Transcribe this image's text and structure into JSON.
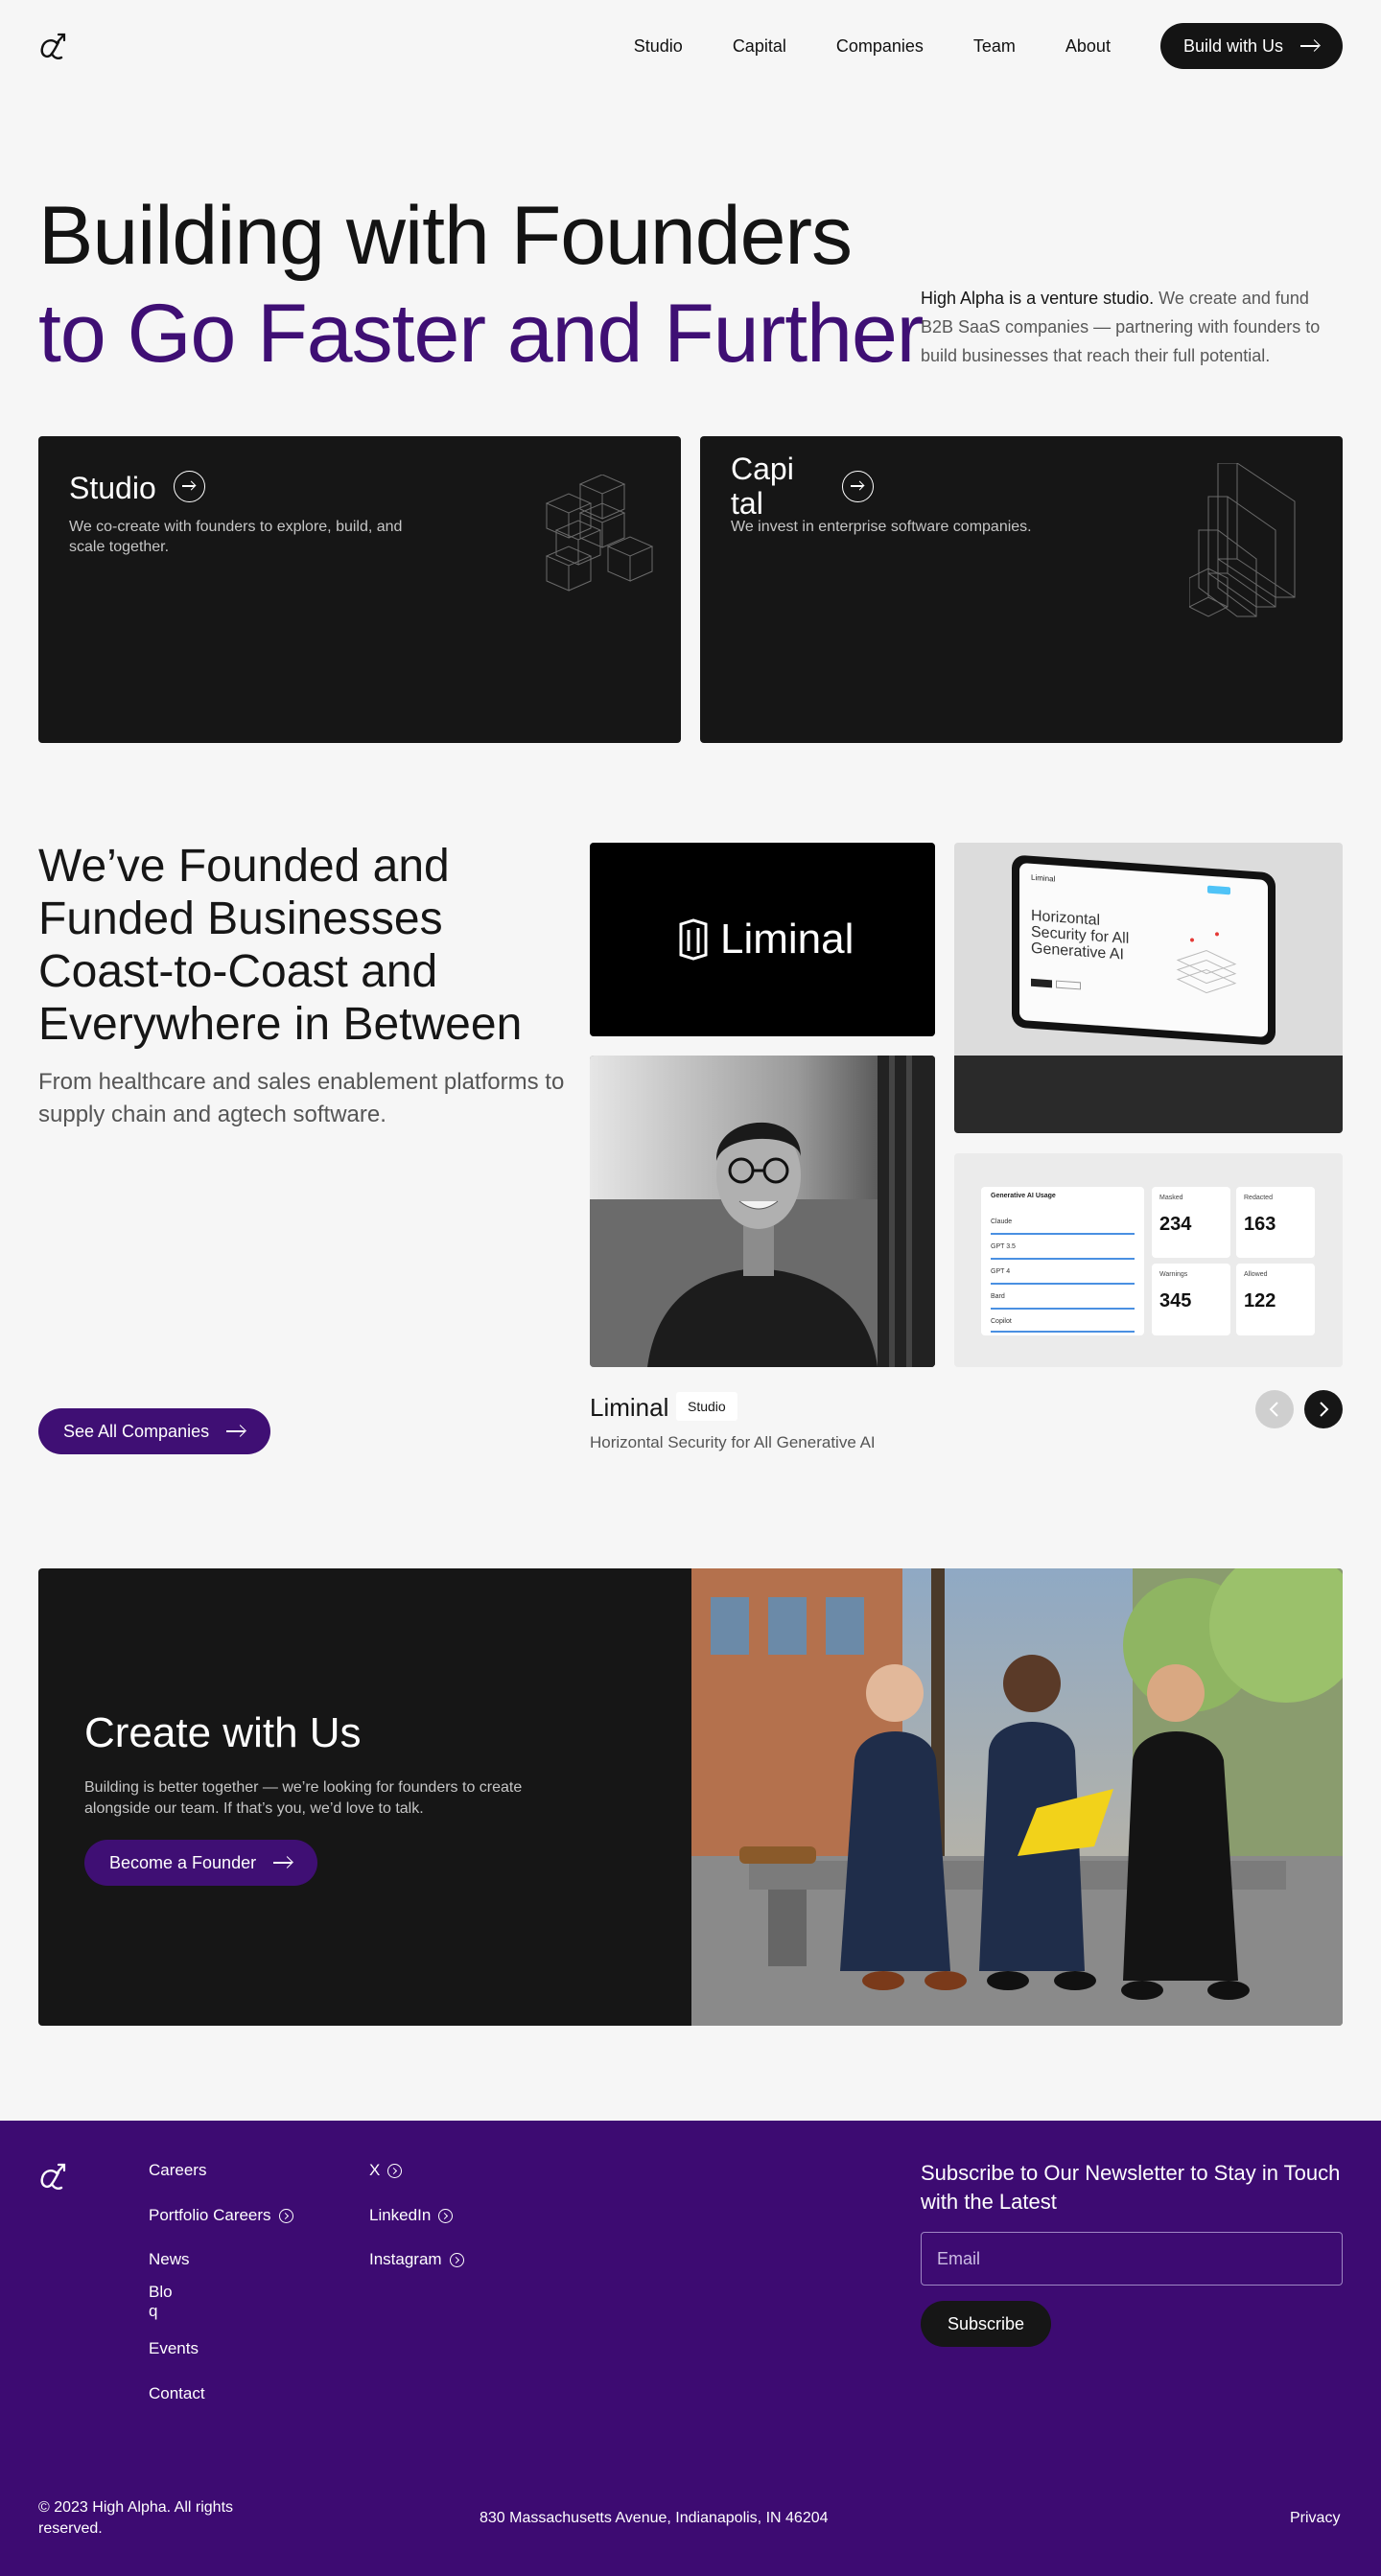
{
  "nav": {
    "items": [
      "Studio",
      "Capital",
      "Companies",
      "Team",
      "About"
    ],
    "cta_label": "Build with Us"
  },
  "hero": {
    "line1": "Building with Founders",
    "line2": "to Go Faster and Further",
    "desc_bold": "High Alpha is a venture studio.",
    "desc_rest": " We create and fund B2B SaaS companies — partnering with founders to build businesses that reach their full potential."
  },
  "cards": {
    "studio": {
      "title": "Studio",
      "desc": "We co-create with founders to explore, build, and scale together."
    },
    "capital": {
      "title_a": "Capi",
      "title_b": "tal",
      "desc": "We invest in enterprise software companies."
    }
  },
  "portfolio": {
    "title": "We’ve Founded and Funded Businesses Coast-to-Coast and Everywhere in Between",
    "subtitle": "From healthcare and sales enablement platforms to supply chain and agtech software.",
    "cta_label": "See All Companies",
    "logo_text": "Liminal",
    "company": {
      "name": "Liminal",
      "tag": "Studio",
      "desc": "Horizontal Security for All Generative AI"
    },
    "laptop": {
      "brand": "Liminal",
      "headline": [
        "Horizontal",
        "Security for All",
        "Generative AI"
      ]
    },
    "dashboard": {
      "panel_title": "Generative AI Usage",
      "rows": [
        "Claude",
        "GPT 3.5",
        "GPT 4",
        "Bard",
        "Copilot"
      ],
      "stats": [
        {
          "label": "Masked",
          "value": "234"
        },
        {
          "label": "Redacted",
          "value": "163"
        },
        {
          "label": "Warnings",
          "value": "345"
        },
        {
          "label": "Allowed",
          "value": "122"
        }
      ]
    }
  },
  "create": {
    "title": "Create with Us",
    "desc": "Building is better together — we’re looking for founders to create alongside our team. If that’s you, we’d love to talk.",
    "cta_label": "Become a Founder"
  },
  "footer": {
    "col1": [
      "Careers",
      "Portfolio Careers",
      "News",
      "Blo",
      "q",
      "Events",
      "Contact"
    ],
    "col2": [
      "X",
      "LinkedIn",
      "Instagram"
    ],
    "newsletter_title": "Subscribe to Our Newsletter to Stay in Touch with the Latest",
    "email_placeholder": "Email",
    "subscribe_label": "Subscribe",
    "copyright": "© 2023 High Alpha. All rights reserved.",
    "address": "830 Massachusetts Avenue, Indianapolis, IN 46204",
    "privacy": "Privacy"
  },
  "colors": {
    "brand_purple": "#3f0f74",
    "footer_purple": "#3d0b72",
    "dark": "#161616",
    "background": "#f6f6f6"
  },
  "icons": [
    "logo-icon",
    "arrow-right-icon",
    "arrow-circle-icon",
    "chevron-left-icon",
    "chevron-right-icon",
    "external-link-icon"
  ]
}
